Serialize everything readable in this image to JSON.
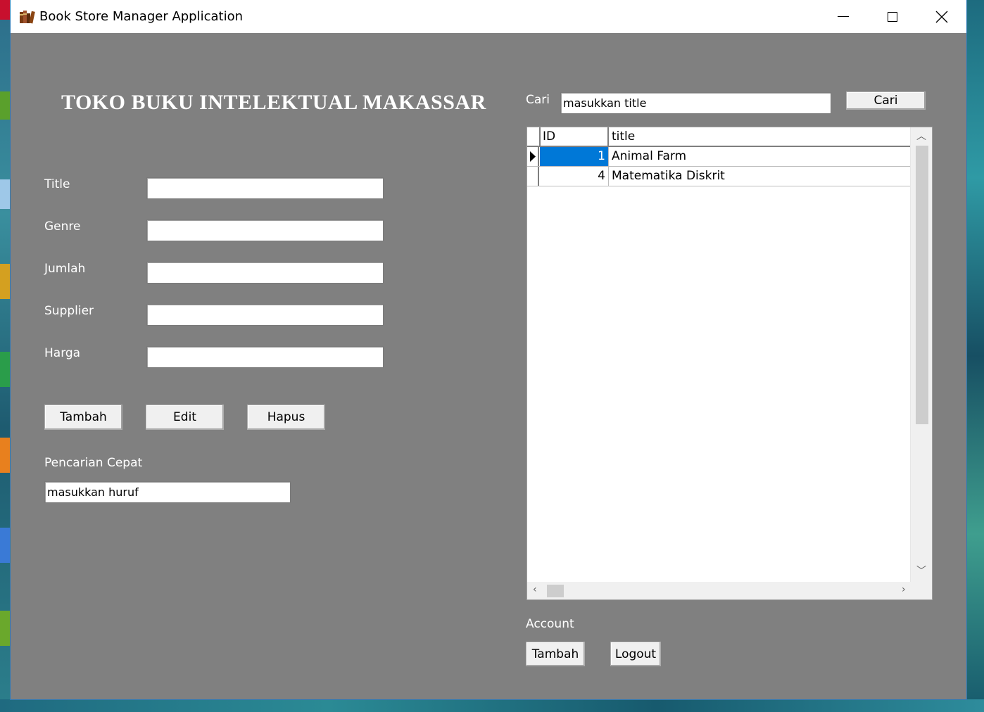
{
  "window": {
    "title": "Book Store Manager Application",
    "minimize": "—",
    "maximize": "☐",
    "close": "✕"
  },
  "heading": "TOKO BUKU INTELEKTUAL MAKASSAR",
  "form": {
    "title_label": "Title",
    "genre_label": "Genre",
    "jumlah_label": "Jumlah",
    "supplier_label": "Supplier",
    "harga_label": "Harga",
    "title_value": "",
    "genre_value": "",
    "jumlah_value": "",
    "supplier_value": "",
    "harga_value": ""
  },
  "buttons": {
    "tambah": "Tambah",
    "edit": "Edit",
    "hapus": "Hapus"
  },
  "quick_search": {
    "label": "Pencarian Cepat",
    "value": "masukkan huruf"
  },
  "search": {
    "label": "Cari",
    "value": "masukkan title",
    "button": "Cari"
  },
  "grid": {
    "columns": [
      "ID",
      "title"
    ],
    "rows": [
      {
        "id": "1",
        "title": "Animal Farm",
        "selected": true
      },
      {
        "id": "4",
        "title": "Matematika Diskrit",
        "selected": false
      }
    ]
  },
  "account": {
    "label": "Account",
    "tambah": "Tambah",
    "logout": "Logout"
  },
  "colors": {
    "form_background": "#808080",
    "selection": "#0078d7"
  }
}
